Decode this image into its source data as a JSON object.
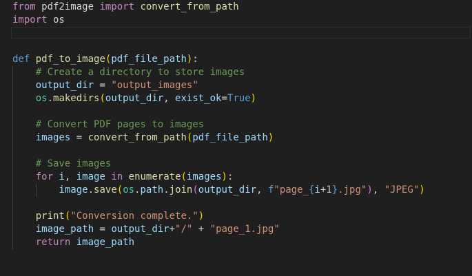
{
  "editor": {
    "language": "python",
    "colors": {
      "background": "#1f1f1f",
      "keyword": "#c586c0",
      "def": "#569cd6",
      "function": "#dcdcaa",
      "variable": "#9cdcfe",
      "string": "#ce9178",
      "comment": "#6a9955"
    }
  },
  "lines": [
    [
      [
        "kw",
        "from"
      ],
      [
        "pun",
        " pdf2image "
      ],
      [
        "kw",
        "import"
      ],
      [
        "fn",
        " convert_from_path"
      ]
    ],
    [
      [
        "kw",
        "import"
      ],
      [
        "pun",
        " os"
      ]
    ],
    [],
    [],
    [
      [
        "def",
        "def"
      ],
      [
        "pun",
        " "
      ],
      [
        "fn",
        "pdf_to_image"
      ],
      [
        "br1",
        "("
      ],
      [
        "var",
        "pdf_file_path"
      ],
      [
        "br1",
        ")"
      ],
      [
        "pun",
        ":"
      ]
    ],
    [
      [
        "pun",
        "    "
      ],
      [
        "cmt",
        "# Create a directory to store images"
      ]
    ],
    [
      [
        "pun",
        "    "
      ],
      [
        "var",
        "output_dir"
      ],
      [
        "op",
        " = "
      ],
      [
        "str",
        "\"output_images\""
      ]
    ],
    [
      [
        "pun",
        "    "
      ],
      [
        "ns",
        "os"
      ],
      [
        "pun",
        "."
      ],
      [
        "fn",
        "makedirs"
      ],
      [
        "br1",
        "("
      ],
      [
        "var",
        "output_dir"
      ],
      [
        "pun",
        ", "
      ],
      [
        "var",
        "exist_ok"
      ],
      [
        "op",
        "="
      ],
      [
        "const",
        "True"
      ],
      [
        "br1",
        ")"
      ]
    ],
    [],
    [
      [
        "pun",
        "    "
      ],
      [
        "cmt",
        "# Convert PDF pages to images"
      ]
    ],
    [
      [
        "pun",
        "    "
      ],
      [
        "var",
        "images"
      ],
      [
        "op",
        " = "
      ],
      [
        "fn",
        "convert_from_path"
      ],
      [
        "br1",
        "("
      ],
      [
        "var",
        "pdf_file_path"
      ],
      [
        "br1",
        ")"
      ]
    ],
    [],
    [
      [
        "pun",
        "    "
      ],
      [
        "cmt",
        "# Save images"
      ]
    ],
    [
      [
        "pun",
        "    "
      ],
      [
        "kw",
        "for"
      ],
      [
        "pun",
        " "
      ],
      [
        "var",
        "i"
      ],
      [
        "pun",
        ", "
      ],
      [
        "var",
        "image"
      ],
      [
        "pun",
        " "
      ],
      [
        "kw",
        "in"
      ],
      [
        "pun",
        " "
      ],
      [
        "fn",
        "enumerate"
      ],
      [
        "br1",
        "("
      ],
      [
        "var",
        "images"
      ],
      [
        "br1",
        ")"
      ],
      [
        "pun",
        ":"
      ]
    ],
    [
      [
        "pun",
        "        "
      ],
      [
        "var",
        "image"
      ],
      [
        "pun",
        "."
      ],
      [
        "fn",
        "save"
      ],
      [
        "br1",
        "("
      ],
      [
        "ns",
        "os"
      ],
      [
        "pun",
        "."
      ],
      [
        "var",
        "path"
      ],
      [
        "pun",
        "."
      ],
      [
        "fn",
        "join"
      ],
      [
        "br2",
        "("
      ],
      [
        "var",
        "output_dir"
      ],
      [
        "pun",
        ", "
      ],
      [
        "tpl",
        "f"
      ],
      [
        "str",
        "\"page_"
      ],
      [
        "tpl",
        "{"
      ],
      [
        "var",
        "i"
      ],
      [
        "op",
        "+"
      ],
      [
        "num",
        "1"
      ],
      [
        "tpl",
        "}"
      ],
      [
        "str",
        ".jpg\""
      ],
      [
        "br2",
        ")"
      ],
      [
        "pun",
        ", "
      ],
      [
        "str",
        "\"JPEG\""
      ],
      [
        "br1",
        ")"
      ]
    ],
    [],
    [
      [
        "pun",
        "    "
      ],
      [
        "fn",
        "print"
      ],
      [
        "br1",
        "("
      ],
      [
        "str",
        "\"Conversion complete.\""
      ],
      [
        "br1",
        ")"
      ]
    ],
    [
      [
        "pun",
        "    "
      ],
      [
        "var",
        "image_path"
      ],
      [
        "op",
        " = "
      ],
      [
        "var",
        "output_dir"
      ],
      [
        "op",
        "+"
      ],
      [
        "str",
        "\"/\""
      ],
      [
        "op",
        " + "
      ],
      [
        "str",
        "\"page_1.jpg\""
      ]
    ],
    [
      [
        "pun",
        "    "
      ],
      [
        "kw",
        "return"
      ],
      [
        "pun",
        " "
      ],
      [
        "var",
        "image_path"
      ]
    ]
  ]
}
